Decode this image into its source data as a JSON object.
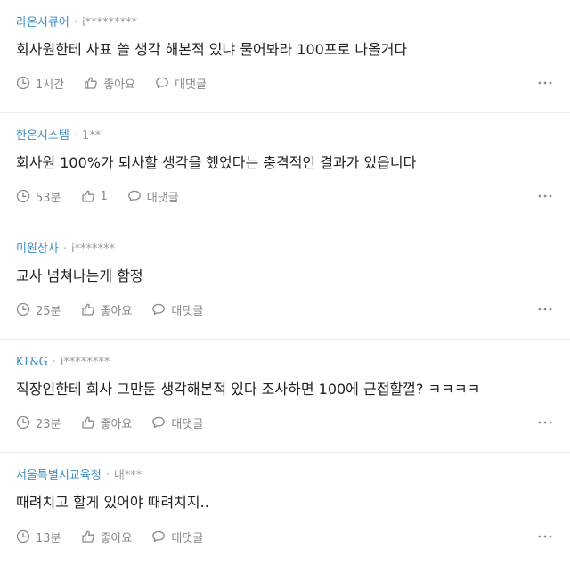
{
  "comments": [
    {
      "company": "라온시큐어",
      "separator": "·",
      "author": "i*********",
      "text": "회사원한테 사표 쓸 생각 해본적 있냐 물어봐라 100프로 나올거다",
      "time": "1시간",
      "like_label": "좋아요",
      "reply_label": "대댓글"
    },
    {
      "company": "한온시스템",
      "separator": "·",
      "author": "1**",
      "text": "회사원 100%가 퇴사할 생각을 했었다는 충격적인 결과가 있읍니다",
      "time": "53분",
      "like_label": "1",
      "reply_label": "대댓글"
    },
    {
      "company": "미원상사",
      "separator": "·",
      "author": "i*******",
      "text": "교사 넘쳐나는게 함정",
      "time": "25분",
      "like_label": "좋아요",
      "reply_label": "대댓글"
    },
    {
      "company": "KT&G",
      "separator": "·",
      "author": "i********",
      "text": "직장인한테 회사 그만둔 생각해본적 있다 조사하면 100에 근접할껄? ㅋㅋㅋㅋ",
      "time": "23분",
      "like_label": "좋아요",
      "reply_label": "대댓글"
    },
    {
      "company": "서울특별시교육청",
      "separator": "·",
      "author": "내***",
      "text": "때려치고 할게 있어야 때려치지..",
      "time": "13분",
      "like_label": "좋아요",
      "reply_label": "대댓글"
    }
  ],
  "icons": {
    "time": "clock-icon",
    "like": "thumbs-up-icon",
    "reply": "speech-bubble-icon",
    "more": "more-horizontal-icon"
  },
  "colors": {
    "company": "#3d8fc6",
    "meta_gray": "#9a9a9a",
    "action_gray": "#888888",
    "text": "#222222",
    "divider": "#ececec"
  }
}
